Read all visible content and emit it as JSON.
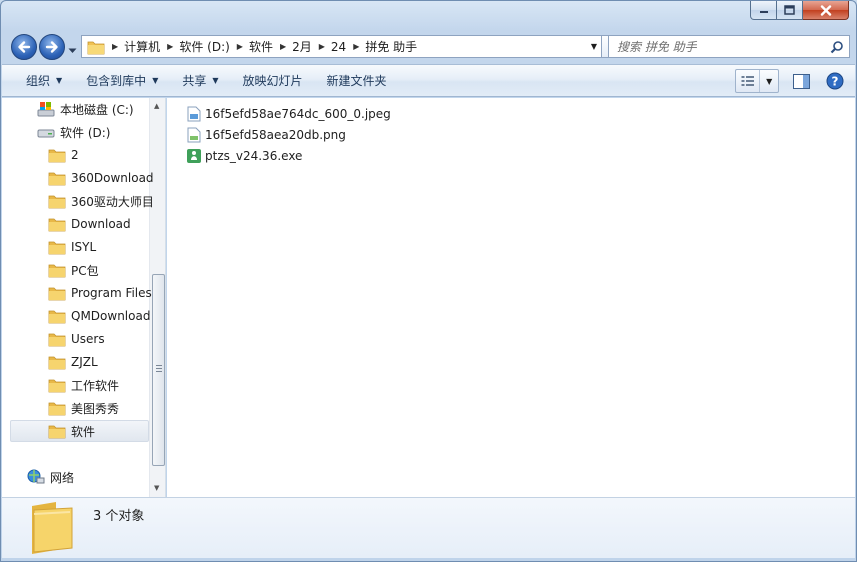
{
  "window": {
    "caption_buttons": [
      {
        "name": "minimize-button",
        "icon": "minimize-icon"
      },
      {
        "name": "maximize-button",
        "icon": "maximize-icon"
      },
      {
        "name": "close-button",
        "icon": "close-icon"
      }
    ]
  },
  "address": {
    "breadcrumbs": [
      "计算机",
      "软件 (D:)",
      "软件",
      "2月",
      "24",
      "拼免 助手"
    ]
  },
  "search": {
    "placeholder": "搜索 拼免 助手"
  },
  "toolbar": {
    "organize": "组织",
    "include_library": "包含到库中",
    "share": "共享",
    "slideshow": "放映幻灯片",
    "new_folder": "新建文件夹"
  },
  "nav": {
    "items": [
      {
        "label": "本地磁盘 (C:)",
        "icon": "drive-c-icon"
      },
      {
        "label": "软件 (D:)",
        "icon": "drive-d-icon"
      },
      {
        "label": "2",
        "icon": "folder-icon"
      },
      {
        "label": "360Download",
        "icon": "folder-icon"
      },
      {
        "label": "360驱动大师目",
        "icon": "folder-icon"
      },
      {
        "label": "Download",
        "icon": "folder-icon"
      },
      {
        "label": "ISYL",
        "icon": "folder-icon"
      },
      {
        "label": "PC包",
        "icon": "folder-icon"
      },
      {
        "label": "Program Files",
        "icon": "folder-icon"
      },
      {
        "label": "QMDownload",
        "icon": "folder-icon"
      },
      {
        "label": "Users",
        "icon": "folder-icon"
      },
      {
        "label": "ZJZL",
        "icon": "folder-icon"
      },
      {
        "label": "工作软件",
        "icon": "folder-icon"
      },
      {
        "label": "美图秀秀",
        "icon": "folder-icon"
      },
      {
        "label": "软件",
        "icon": "folder-icon",
        "selected": true
      }
    ],
    "network": {
      "label": "网络",
      "icon": "network-icon"
    }
  },
  "files": [
    {
      "name": "16f5efd58ae764dc_600_0.jpeg",
      "icon": "jpeg-file-icon"
    },
    {
      "name": "16f5efd58aea20db.png",
      "icon": "png-file-icon"
    },
    {
      "name": "ptzs_v24.36.exe",
      "icon": "exe-file-icon"
    }
  ],
  "details": {
    "count_text": "3 个对象"
  },
  "colors": {
    "accent": "#2d63b7",
    "folder": "#f3c85b",
    "selected_bg": "#e1e7ef"
  }
}
